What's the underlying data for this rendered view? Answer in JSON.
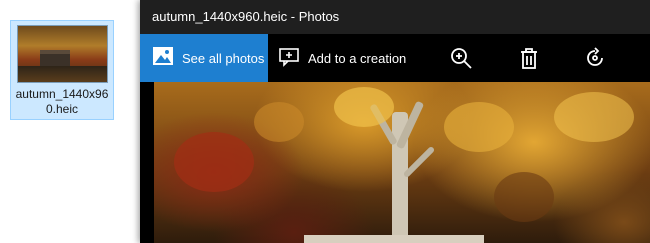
{
  "explorer": {
    "file_name": "autumn_1440x96\n0.heic"
  },
  "window": {
    "title": "autumn_1440x960.heic - Photos"
  },
  "toolbar": {
    "see_all_label": "See all photos",
    "add_creation_label": "Add to a creation",
    "icons": [
      "gallery-icon",
      "add-to-creation-icon",
      "zoom-in-icon",
      "delete-icon",
      "rotate-icon"
    ]
  },
  "colors": {
    "accent": "#1e7fd0",
    "titlebar": "#1f1f1f",
    "toolbar": "#000000",
    "selection": "#cce8ff"
  }
}
